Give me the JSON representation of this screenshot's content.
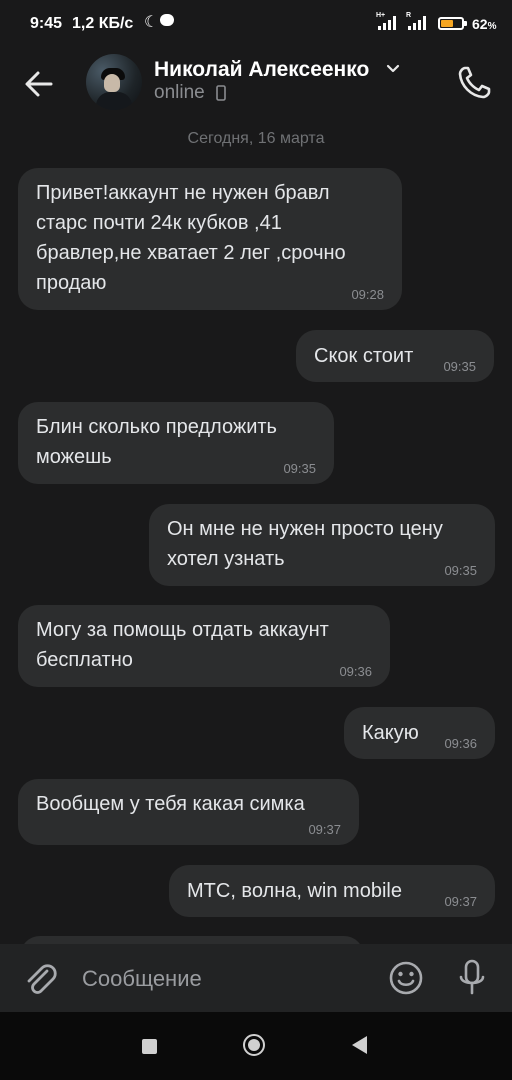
{
  "status_bar": {
    "time": "9:45",
    "speed": "1,2 КБ/с",
    "battery_percent": "62",
    "battery_suffix": "%",
    "battery_level": 0.62,
    "battery_color": "#f5a623",
    "net_label_1": "H+",
    "net_label_2": "R"
  },
  "header": {
    "contact_name": "Николай Алексеенко",
    "status": "online",
    "icons": [
      "back-arrow-icon",
      "chevron-down-icon",
      "mobile-phone-icon",
      "phone-call-icon"
    ]
  },
  "conversation": {
    "date_label": "Сегодня, 16 марта",
    "messages": [
      {
        "side": "in",
        "text": "Привет!аккаунт не нужен бравл старс почти 24к кубков ,41 бравлер,не хватает 2 лег ,срочно продаю",
        "time": "09:28"
      },
      {
        "side": "out",
        "text": "Скок стоит",
        "time": "09:35"
      },
      {
        "side": "in",
        "text": "Блин сколько предложить можешь",
        "time": "09:35"
      },
      {
        "side": "out",
        "text": "Он мне не нужен просто цену хотел узнать",
        "time": "09:35"
      },
      {
        "side": "in",
        "text": "Могу за помощь отдать аккаунт бесплатно",
        "time": "09:36"
      },
      {
        "side": "out",
        "text": "Какую",
        "time": "09:36"
      },
      {
        "side": "in",
        "text": "Вообщем у тебя какая симка",
        "time": "09:37"
      },
      {
        "side": "out",
        "text": "МТС, волна, win mobile",
        "time": "09:37"
      }
    ]
  },
  "composer": {
    "placeholder": "Сообщение",
    "icons": [
      "paperclip-icon",
      "emoji-icon",
      "microphone-icon"
    ]
  },
  "colors": {
    "background": "#19191a",
    "bubble": "#2c2d2e",
    "text": "#e4e6e9",
    "muted": "#8b8d91"
  }
}
